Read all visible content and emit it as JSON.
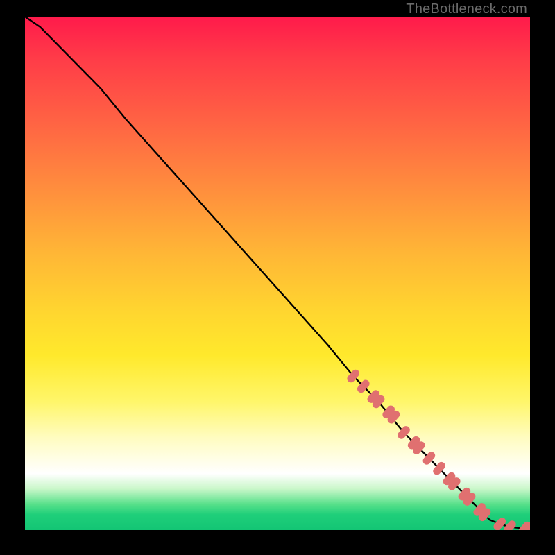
{
  "watermark": "TheBottleneck.com",
  "chart_data": {
    "type": "line",
    "title": "",
    "xlabel": "",
    "ylabel": "",
    "xlim": [
      0,
      100
    ],
    "ylim": [
      0,
      100
    ],
    "grid": false,
    "legend": false,
    "series": [
      {
        "name": "curve",
        "color": "#000000",
        "x": [
          0,
          3,
          6,
          10,
          15,
          20,
          30,
          40,
          50,
          60,
          65,
          70,
          75,
          80,
          85,
          88,
          90,
          92,
          94,
          96,
          98,
          100
        ],
        "y": [
          100,
          98,
          95,
          91,
          86,
          80,
          69,
          58,
          47,
          36,
          30,
          25,
          19,
          14,
          9,
          6,
          4,
          2,
          1.2,
          0.6,
          0.4,
          0.4
        ]
      }
    ],
    "markers": [
      {
        "name": "clusters",
        "color": "#e07070",
        "points": [
          {
            "x": 65,
            "y": 30
          },
          {
            "x": 67,
            "y": 28
          },
          {
            "x": 69,
            "y": 26
          },
          {
            "x": 70,
            "y": 25
          },
          {
            "x": 72,
            "y": 23
          },
          {
            "x": 73,
            "y": 22
          },
          {
            "x": 75,
            "y": 19
          },
          {
            "x": 77,
            "y": 17
          },
          {
            "x": 78,
            "y": 16
          },
          {
            "x": 80,
            "y": 14
          },
          {
            "x": 82,
            "y": 12
          },
          {
            "x": 84,
            "y": 10
          },
          {
            "x": 85,
            "y": 9
          },
          {
            "x": 87,
            "y": 7
          },
          {
            "x": 88,
            "y": 6
          },
          {
            "x": 90,
            "y": 4
          },
          {
            "x": 91,
            "y": 3
          },
          {
            "x": 94,
            "y": 1.2
          },
          {
            "x": 96,
            "y": 0.6
          },
          {
            "x": 99,
            "y": 0.4
          },
          {
            "x": 100,
            "y": 0.4
          }
        ]
      }
    ]
  }
}
